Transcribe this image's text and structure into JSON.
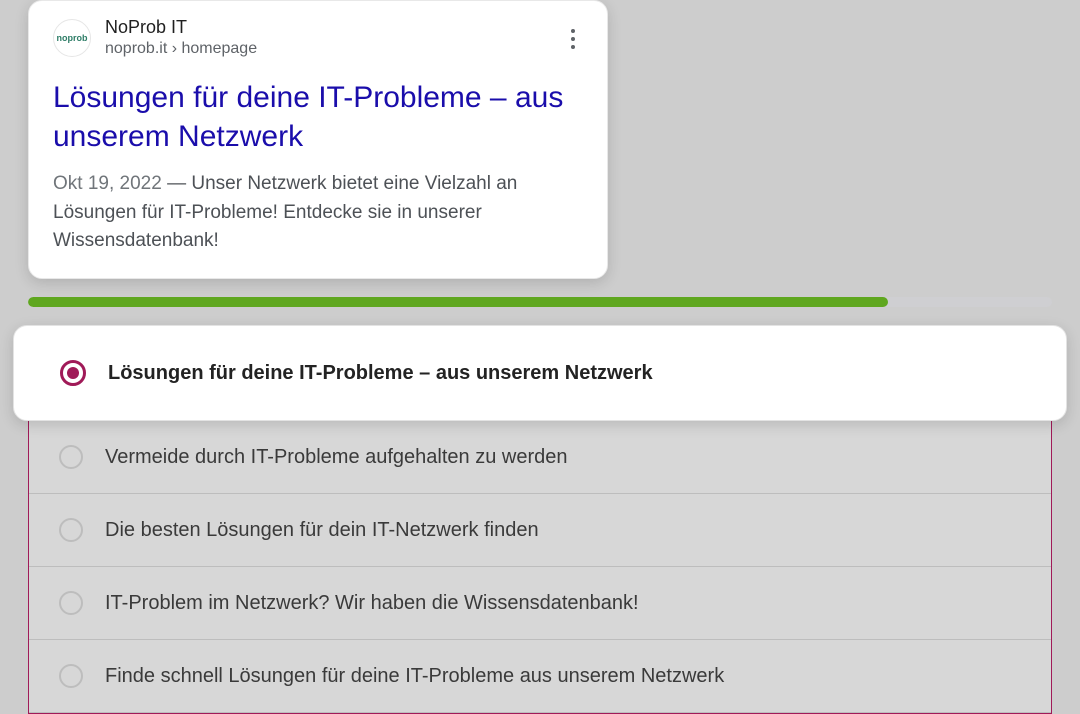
{
  "serp": {
    "favicon_label": "noprob",
    "site_name": "NoProb IT",
    "breadcrumb": "noprob.it › homepage",
    "title": "Lösungen für deine IT-Probleme – aus unserem Netzwerk",
    "date": "Okt 19, 2022",
    "snippet": "Unser Netzwerk bietet eine Vielzahl an Lösungen für IT-Probleme! Entdecke sie in unserer Wissensdatenbank!"
  },
  "progress": {
    "percent": 84
  },
  "options": {
    "accent": "#a01a58",
    "selected_index": 0,
    "items": [
      {
        "label": "Lösungen für deine IT-Probleme – aus unserem Netzwerk"
      },
      {
        "label": "Vermeide durch IT-Probleme aufgehalten zu werden"
      },
      {
        "label": "Die besten Lösungen für dein IT-Netzwerk finden"
      },
      {
        "label": "IT-Problem im Netzwerk? Wir haben die Wissensdatenbank!"
      },
      {
        "label": "Finde schnell Lösungen für deine IT-Probleme aus unserem Netzwerk"
      }
    ]
  }
}
